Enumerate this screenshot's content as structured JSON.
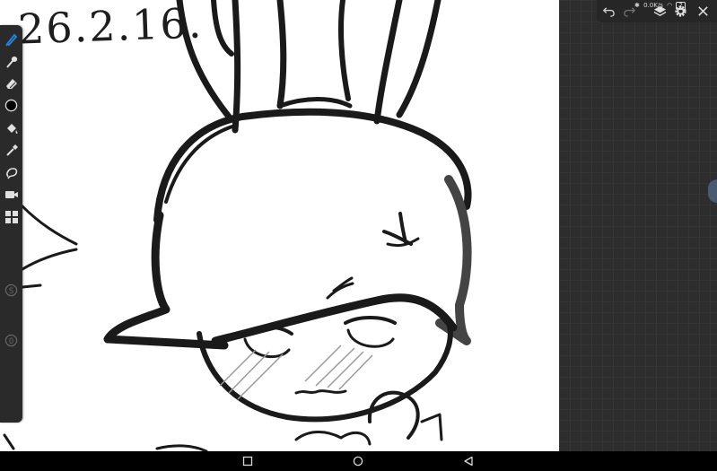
{
  "canvas": {
    "date_text": "26.2.16."
  },
  "toolbar": {
    "tools": [
      {
        "name": "brush-tool",
        "icon": "brush-icon",
        "active": true
      },
      {
        "name": "smudge-tool",
        "icon": "smudge-icon"
      },
      {
        "name": "eraser-tool",
        "icon": "eraser-icon"
      },
      {
        "name": "color-picker",
        "icon": "color-swatch-icon",
        "color": "#000000"
      },
      {
        "name": "fill-tool",
        "icon": "paint-bucket-icon"
      },
      {
        "name": "eyedropper-tool",
        "icon": "eyedropper-icon"
      },
      {
        "name": "lasso-tool",
        "icon": "lasso-icon"
      },
      {
        "name": "record-tool",
        "icon": "video-camera-icon"
      },
      {
        "name": "gallery-tool",
        "icon": "grid-icon"
      }
    ],
    "symmetry_button": "S",
    "opacity_button": "0",
    "accent_color": "#1e88e5"
  },
  "top_bar": {
    "buttons": [
      {
        "name": "undo-button",
        "icon": "undo-icon"
      },
      {
        "name": "redo-button",
        "icon": "redo-icon"
      },
      {
        "name": "layers-button",
        "icon": "layers-icon"
      },
      {
        "name": "settings-button",
        "icon": "gear-icon"
      },
      {
        "name": "close-button",
        "icon": "close-icon"
      }
    ]
  },
  "status_bar": {
    "speed": "0.0K/s",
    "battery": "2"
  },
  "nav_bar": {
    "buttons": [
      {
        "name": "recents-button",
        "icon": "square-icon"
      },
      {
        "name": "home-button",
        "icon": "circle-icon"
      },
      {
        "name": "back-button",
        "icon": "triangle-back-icon"
      }
    ]
  }
}
